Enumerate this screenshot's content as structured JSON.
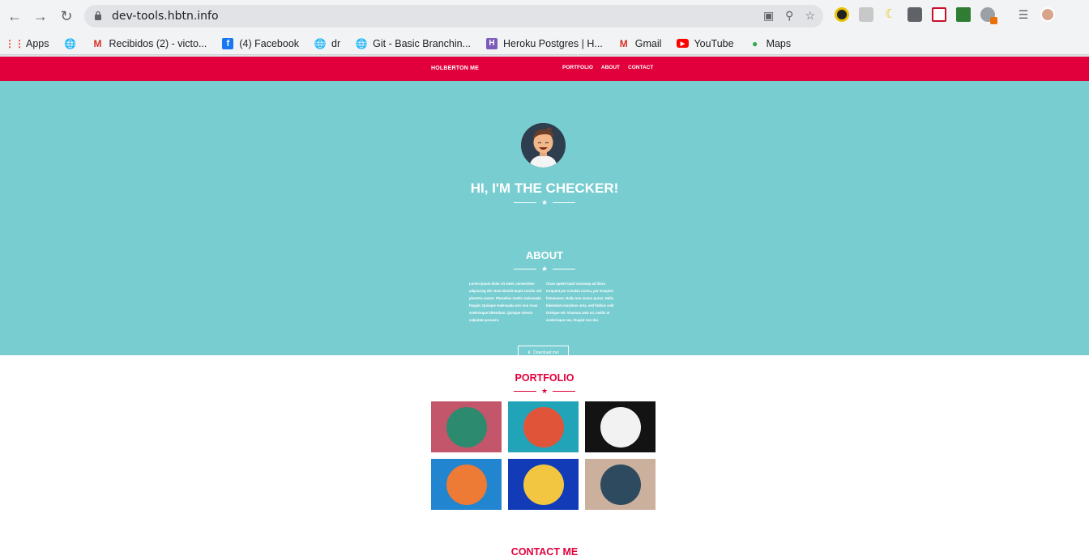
{
  "browser": {
    "url": "dev-tools.hbtn.info",
    "bookmarks": [
      {
        "label": "Apps",
        "icon": "apps-grid-icon"
      },
      {
        "label": "",
        "icon": "globe-icon"
      },
      {
        "label": "Recibidos (2) - victo...",
        "icon": "gmail-icon"
      },
      {
        "label": "(4) Facebook",
        "icon": "facebook-icon"
      },
      {
        "label": "dr",
        "icon": "globe-icon"
      },
      {
        "label": "Git - Basic Branchin...",
        "icon": "globe-icon"
      },
      {
        "label": "Heroku Postgres | H...",
        "icon": "heroku-icon"
      },
      {
        "label": "Gmail",
        "icon": "gmail-icon"
      },
      {
        "label": "YouTube",
        "icon": "youtube-icon"
      },
      {
        "label": "Maps",
        "icon": "maps-icon"
      }
    ]
  },
  "nav": {
    "brand": "HOLBERTON ME",
    "links": [
      "PORTFOLIO",
      "ABOUT",
      "CONTACT"
    ]
  },
  "hero": {
    "title": "HI, I'M THE CHECKER!"
  },
  "about": {
    "title": "ABOUT",
    "col1": "Lorem ipsum dolor sit amet, consectetur adipiscing elit. Nam blandit turpis iaculis nisl pharetra auctor. Phasellus mattis malesuada feugiat. Quisque malesuada orci non risus scelerisque bibendum. Quisque viverra vulputate posuere.",
    "col2": "Class aptent taciti sociosqu ad litora torquent per conubia nostra, per inceptos himenaeos. Nulla non ornare purus. Nulla bibendum maximus urna, sed finibus velit tristique vel. Vivamus ante mi, mollis at scelerisque nec, feugiat non dui.",
    "download_label": "Download me!"
  },
  "portfolio": {
    "title": "PORTFOLIO",
    "items": [
      {
        "name": "cabin",
        "bg": "#c3566a",
        "circle": "#2c8a6e"
      },
      {
        "name": "cake",
        "bg": "#22a4b8",
        "circle": "#e0543a"
      },
      {
        "name": "circus",
        "bg": "#131313",
        "circle": "#f2f2f2"
      },
      {
        "name": "game-controller",
        "bg": "#2285cf",
        "circle": "#ed7a35"
      },
      {
        "name": "safe",
        "bg": "#123bb8",
        "circle": "#f2c640"
      },
      {
        "name": "submarine",
        "bg": "#ccb09e",
        "circle": "#2e4a5e"
      }
    ]
  },
  "contact": {
    "title": "CONTACT ME"
  },
  "colors": {
    "accent": "#e1003c",
    "hero_bg": "#78cdd1"
  }
}
